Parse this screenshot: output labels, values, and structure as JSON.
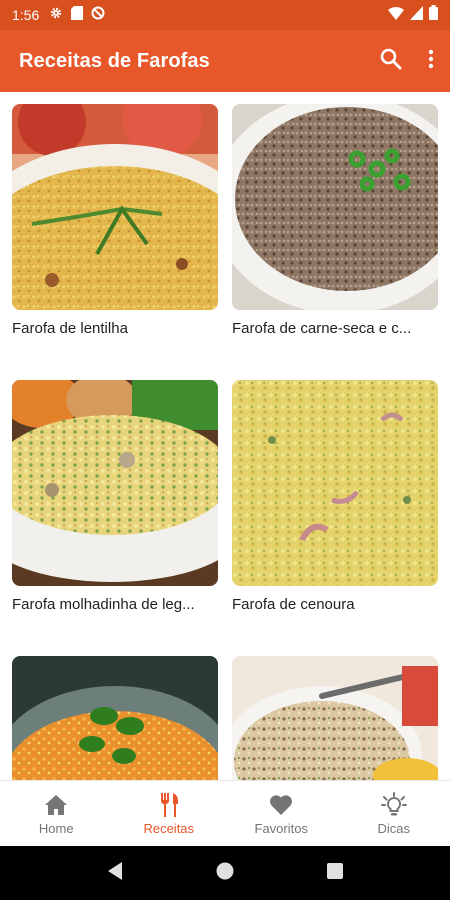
{
  "status_bar": {
    "time": "1:56"
  },
  "app_bar": {
    "title": "Receitas de Farofas"
  },
  "recipes": [
    {
      "title": "Farofa de lentilha"
    },
    {
      "title": "Farofa de carne-seca e c..."
    },
    {
      "title": "Farofa molhadinha de leg..."
    },
    {
      "title": "Farofa de cenoura"
    },
    {
      "title": ""
    },
    {
      "title": ""
    }
  ],
  "bottom_nav": {
    "items": [
      {
        "label": "Home",
        "icon": "home-icon"
      },
      {
        "label": "Receitas",
        "icon": "fork-knife-icon",
        "active": true
      },
      {
        "label": "Favoritos",
        "icon": "heart-icon"
      },
      {
        "label": "Dicas",
        "icon": "lightbulb-icon"
      }
    ]
  },
  "colors": {
    "primary": "#e8572a",
    "status_bar": "#d9501f",
    "inactive": "#757575"
  }
}
